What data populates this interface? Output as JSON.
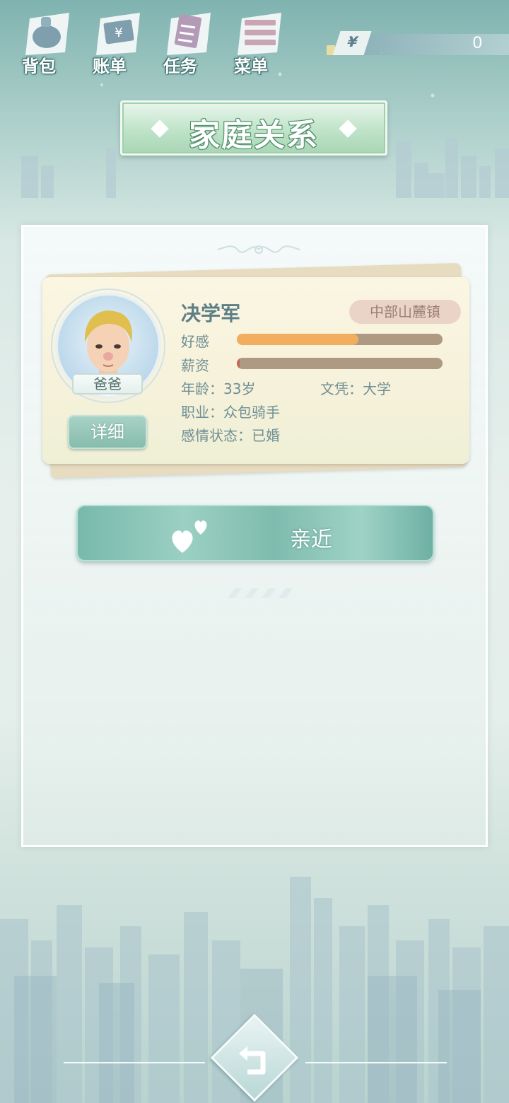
{
  "topbar": {
    "buttons": [
      {
        "label": "背包",
        "icon": "backpack-icon"
      },
      {
        "label": "账单",
        "icon": "bill-icon"
      },
      {
        "label": "任务",
        "icon": "task-icon"
      },
      {
        "label": "菜单",
        "icon": "menu-icon"
      }
    ],
    "money": {
      "symbol": "¥",
      "value": "0"
    }
  },
  "title": "家庭关系",
  "character": {
    "name": "决学军",
    "relation": "爸爸",
    "location": "中部山麓镇",
    "stats": {
      "affection_label": "好感",
      "affection_level": 0.59,
      "salary_label": "薪资",
      "salary_level": 0.01
    },
    "age_text": "年龄：33岁",
    "education_text": "文凭：大学",
    "occupation_text": "职业：众包骑手",
    "relationship_text": "感情状态：已婚",
    "detail_button": "详细"
  },
  "actions": {
    "approach_label": "亲近"
  },
  "colors": {
    "affection_fill": "#f2ad5e",
    "salary_fill": "#c0685b",
    "bar_track": "#ae9a83",
    "accent": "#7fbcae"
  }
}
